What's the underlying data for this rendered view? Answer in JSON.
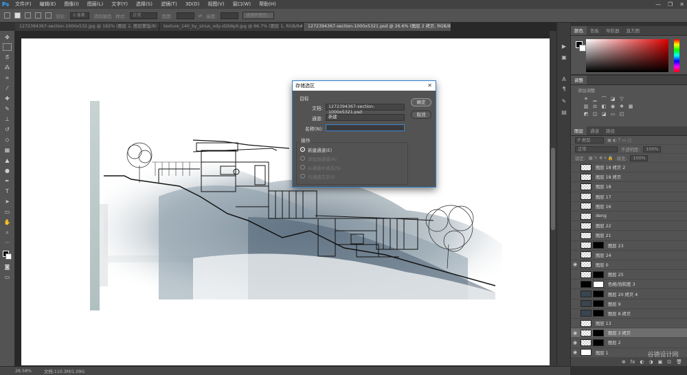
{
  "app": {
    "logo": "Ps"
  },
  "menu": [
    "文件(F)",
    "编辑(E)",
    "图像(I)",
    "图层(L)",
    "文字(Y)",
    "选择(S)",
    "滤镜(T)",
    "3D(D)",
    "视图(V)",
    "窗口(W)",
    "帮助(H)"
  ],
  "window_controls": [
    "—",
    "❐",
    "✕"
  ],
  "options": {
    "feather_label": "羽化:",
    "feather_value": "0 像素",
    "antialias_label": "消除锯齿",
    "style_label": "样式:",
    "style_value": "正常",
    "width_label": "宽度:",
    "height_label": "高度:",
    "select_mask_label": "选择并遮住..."
  },
  "tabs": [
    "1272394367-section-1000x532.jpg @ 192% (图层 2, 图层蒙版/8) *",
    "texture_140_by_sinus_ody-d2b9p9.jpg @ 66.7% (图层 1, RGB/8#) *",
    "1272394367-section-1000x5321.psd @ 26.6% (图层 2 拷贝, RGB/8#) *"
  ],
  "active_tab": 2,
  "status": {
    "zoom": "26.58%",
    "doc_size": "文档:110.3M/1.09G"
  },
  "color_panel": {
    "tabs": [
      "颜色",
      "色板",
      "导航器",
      "直方图"
    ],
    "accent": "#e00000"
  },
  "adjustments_panel": {
    "tabs": [
      "调整"
    ],
    "title": "添加调整"
  },
  "layers_panel": {
    "tabs": [
      "图层",
      "通道",
      "路径"
    ],
    "filter_label": "P 类型",
    "blend_mode": "正常",
    "opacity_label": "不透明度:",
    "opacity_value": "100%",
    "lock_label": "锁定:",
    "fill_label": "填充:",
    "fill_value": "100%",
    "layers": [
      {
        "name": "图层 18 拷贝 2",
        "visible": false,
        "thumb": "check",
        "mask": "none",
        "selected": false
      },
      {
        "name": "图层 18 拷贝",
        "visible": false,
        "thumb": "check",
        "mask": "none",
        "selected": false
      },
      {
        "name": "图层 18",
        "visible": false,
        "thumb": "check",
        "mask": "none",
        "selected": false
      },
      {
        "name": "图层 17",
        "visible": false,
        "thumb": "check",
        "mask": "none",
        "selected": false
      },
      {
        "name": "图层 16",
        "visible": false,
        "thumb": "check",
        "mask": "none",
        "selected": false
      },
      {
        "name": "deng",
        "visible": false,
        "thumb": "check",
        "mask": "none",
        "selected": false
      },
      {
        "name": "图层 22",
        "visible": false,
        "thumb": "check",
        "mask": "none",
        "selected": false
      },
      {
        "name": "图层 21",
        "visible": false,
        "thumb": "check",
        "mask": "none",
        "selected": false
      },
      {
        "name": "图层 23",
        "visible": false,
        "thumb": "check",
        "mask": "black",
        "selected": false
      },
      {
        "name": "图层 24",
        "visible": false,
        "thumb": "check",
        "mask": "none",
        "selected": false
      },
      {
        "name": "图层 0",
        "visible": true,
        "thumb": "check",
        "mask": "none",
        "selected": false
      },
      {
        "name": "图层 25",
        "visible": false,
        "thumb": "check",
        "mask": "black",
        "selected": false
      },
      {
        "name": "色相/饱和度 3",
        "visible": false,
        "thumb": "adj",
        "mask": "white",
        "selected": false
      },
      {
        "name": "图层 20 拷贝 4",
        "visible": false,
        "thumb": "dark",
        "mask": "black",
        "selected": false
      },
      {
        "name": "图层 9",
        "visible": false,
        "thumb": "dark",
        "mask": "black",
        "selected": false
      },
      {
        "name": "图层 8 拷贝",
        "visible": false,
        "thumb": "dark",
        "mask": "black",
        "selected": false
      },
      {
        "name": "图层 13",
        "visible": false,
        "thumb": "check",
        "mask": "none",
        "selected": false
      },
      {
        "name": "图层 2 拷贝",
        "visible": true,
        "thumb": "check",
        "mask": "black",
        "selected": true
      },
      {
        "name": "图层 2",
        "visible": true,
        "thumb": "check",
        "mask": "black",
        "selected": false
      },
      {
        "name": "图层 1",
        "visible": true,
        "thumb": "white",
        "mask": "none",
        "selected": false
      }
    ],
    "footer_icons": [
      "⊗",
      "fx",
      "◐",
      "◑",
      "▣",
      "⊡",
      "🗑"
    ]
  },
  "dialog": {
    "title": "存储选区",
    "target_label": "目标",
    "doc_label": "文档:",
    "doc_value": "1272394367-section-1000x5321.psd",
    "channel_label": "通道:",
    "channel_value": "新建",
    "name_label": "名称(N):",
    "name_value": "",
    "ok_label": "确定",
    "cancel_label": "取消",
    "operation_label": "操作",
    "operations": [
      {
        "label": "新建通道(E)",
        "selected": true
      },
      {
        "label": "添加到通道(A)",
        "selected": false
      },
      {
        "label": "从通道中减去(S)",
        "selected": false
      },
      {
        "label": "与通道交叉(I)",
        "selected": false
      }
    ]
  },
  "watermark": "谷德设计网"
}
